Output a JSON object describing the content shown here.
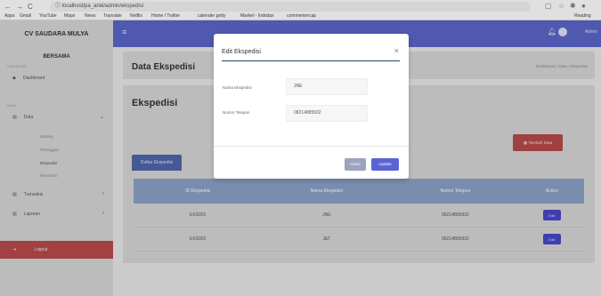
{
  "browser": {
    "back": "←",
    "forward": "→",
    "reload": "C",
    "info": "ⓘ",
    "url": "localhost/pa_ariel/admin/ekspedisi",
    "bookmarks": [
      "Apps",
      "Gmail",
      "YouTube",
      "Maps",
      "News",
      "Translate",
      "Netflix",
      "Home / Twitter",
      "calender getty",
      "Market - Indodax",
      "commentercap"
    ],
    "reading_list": "Reading"
  },
  "sidebar": {
    "brand": "CV SAUDARA MULYA",
    "brand2": "BERSAMA",
    "section1": "DASHBOARD",
    "dashboard": "Dashboard",
    "section2": "MENU",
    "data": "Data",
    "sub": [
      "Barang",
      "Pelanggan",
      "Ekspedisi",
      "Merchant"
    ],
    "transaksi": "Transaksi",
    "laporan": "Laporan",
    "logout": "Logout"
  },
  "topbar": {
    "user": "Admin"
  },
  "header": {
    "title": "Data Ekspedisi",
    "breadcrumb": "Dashboard / Data / Ekspedisi"
  },
  "main": {
    "title": "Ekspedisi",
    "add_label": "Tambah Data",
    "tab_label": "Daftar Ekspedisi",
    "columns": [
      "ID Ekspedisi",
      "Nama Ekspedisi",
      "Nomor Telepon",
      "Action"
    ],
    "rows": [
      {
        "id": "EKS001",
        "nama": "JNE",
        "telp": "08214885932",
        "action": "Edit"
      },
      {
        "id": "EKS002",
        "nama": "J&T",
        "telp": "08214885932",
        "action": "Edit"
      }
    ]
  },
  "modal": {
    "title": "Edit Ekspedisi",
    "close": "×",
    "nama_label": "Nama Ekspedisi",
    "nama_value": "JNE",
    "telp_label": "Nomor Telepon",
    "telp_value": "08214885932",
    "close_btn": "Close",
    "update_btn": "Update"
  },
  "colors": {
    "primary": "#5966c8",
    "danger": "#b5494a",
    "table_header": "#8aa2c8",
    "sidebar": "#d7d7d7"
  }
}
